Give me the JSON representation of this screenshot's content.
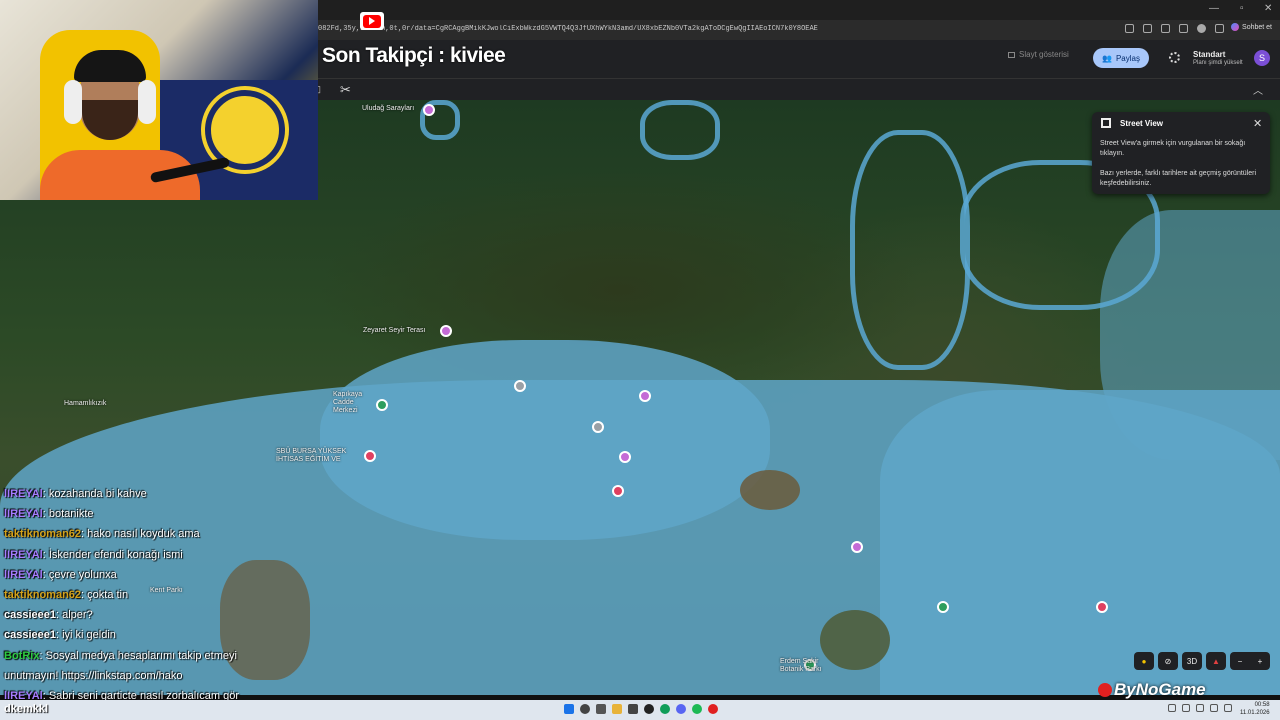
{
  "browser": {
    "url": "082Fd,35y,t                 71h,0t,0r/data=CgRCAggBMikKJwolCiExbWkzdG5VWTQ4Q3JfUXhWYkN3amd/UX8xbEZNb0V... ",
    "url_text": "082Fd,35y,1t          71h,0t,0r/data=CgRCAggBMikKJwolCiExbWkzdG5VWTQ4Q3JfUXhWYkN3amd/UX8xbEZNb0VTa2kgAToDCgEwQgIIAEoICN7k0Y8OEAE",
    "chat_button": "Sohbet et"
  },
  "overlay": {
    "title": "Son Takipçi : kiviee"
  },
  "earth_header": {
    "slideshow": "Slayt gösterisi",
    "share": "Paylaş",
    "plan_title": "Standart",
    "plan_sub": "Planı şimdi yükselt",
    "avatar": "S"
  },
  "street_view": {
    "title": "Street View",
    "body1": "Street View'a girmek için vurgulanan bir sokağı tıklayın.",
    "body2": "Bazı yerlerde, farklı tarihlere ait geçmiş görüntüleri keşfedebilirsiniz."
  },
  "map_labels": {
    "uludag": "Uludağ Sarayları",
    "zeyaret": "Zeyaret Seyir Terası",
    "hamamlikizik": "Hamamlıkızık",
    "kapikaya": "Kapıkaya\nCadde\nMerkezi",
    "sbu": "SBÜ BURSA YÜKSEK\nİHTİSAS EĞİTİM VE",
    "erdem": "Erdem Şakir\nBotanik Parkı",
    "kent": "Kent Parkı"
  },
  "map_controls": {
    "three_d": "3D"
  },
  "chat": [
    {
      "user": "lIREYAl",
      "msg": ": kozahanda bi kahve",
      "color": "#a67cff"
    },
    {
      "user": "lIREYAl",
      "msg": ": botanikte",
      "color": "#a67cff"
    },
    {
      "user": "taktiknoman62",
      "msg": ": hako nasıl koyduk ama",
      "color": "#d4a21a"
    },
    {
      "user": "lIREYAl",
      "msg": ": İskender efendi konağı ismi",
      "color": "#a67cff"
    },
    {
      "user": "lIREYAl",
      "msg": ": çevre yolunxa",
      "color": "#a67cff"
    },
    {
      "user": "taktiknoman62",
      "msg": ": çokta tin",
      "color": "#d4a21a"
    },
    {
      "user": "cassieee1",
      "msg": ": alper?",
      "color": "#ffffff"
    },
    {
      "user": "cassieee1",
      "msg": ": iyi ki geldin",
      "color": "#ffffff"
    },
    {
      "user": "BotRix",
      "msg": ": Sosyal medya hesaplarımı takip etmeyi",
      "color": "#2ecc40"
    },
    {
      "user": "",
      "msg": "unutmayın! https://linkstap.com/hako",
      "color": "#ffffff"
    },
    {
      "user": "lIREYAl",
      "msg": ": Sabri seni garticte nasıl zorbalıcam gör",
      "color": "#a67cff"
    }
  ],
  "watermark": "ByNoGame",
  "taskbar": {
    "overlay_name": "dkemkkl",
    "time": "00:58",
    "date": "11.01.2026"
  }
}
